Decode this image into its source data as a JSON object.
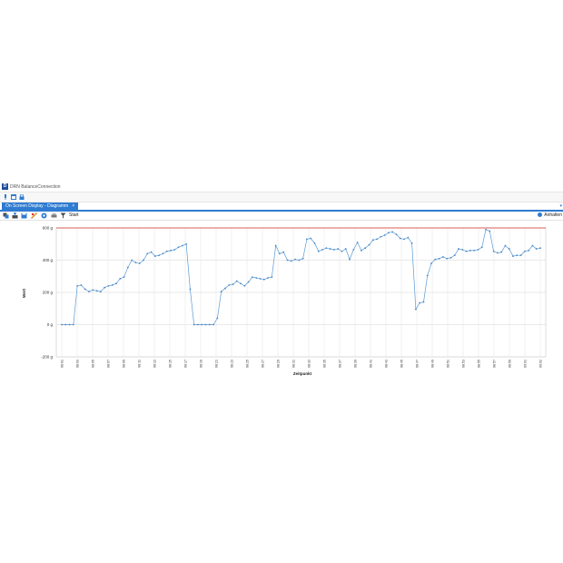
{
  "window": {
    "title": "DRN BalanceConnection",
    "icon_letter": "D",
    "document_tab": "On Screen Display - Diagramm",
    "tab_close": "×",
    "tab_scroll": "▾",
    "toolbar": {
      "start_label": "Start",
      "pause_label": "Anhalten"
    },
    "quick_icons": [
      "pin-icon",
      "layout-icon",
      "lock-icon"
    ],
    "toolbar_icons": [
      "copy-icon",
      "export-icon",
      "save-icon",
      "marker-icon",
      "settings-icon",
      "print-icon",
      "filter-icon"
    ]
  },
  "colors": {
    "accent": "#2f7bd1",
    "series": "#5b9bd5",
    "limit_line": "#d9322a"
  },
  "chart_data": {
    "type": "line",
    "xlabel": "Zeitpunkt",
    "ylabel": "Wert",
    "ylim": [
      -200,
      600
    ],
    "yticks": [
      -200,
      0,
      200,
      400,
      600
    ],
    "ytick_labels": [
      "-200 g",
      "0 g",
      "200 g",
      "400 g",
      "600 g"
    ],
    "limit_value": 600,
    "grid": true,
    "xtick_labels": [
      "08:01",
      "08:03",
      "08:05",
      "08:07",
      "08:09",
      "08:11",
      "08:13",
      "08:15",
      "08:17",
      "08:19",
      "08:21",
      "08:23",
      "08:25",
      "08:27",
      "08:29",
      "08:31",
      "08:33",
      "08:35",
      "08:37",
      "08:39",
      "08:41",
      "08:43",
      "08:45",
      "08:47",
      "08:49",
      "08:51",
      "08:53",
      "08:55",
      "08:57",
      "08:59",
      "09:01",
      "09:02"
    ],
    "series": [
      {
        "values": [
          0,
          0,
          0,
          0,
          240,
          245,
          220,
          205,
          215,
          210,
          205,
          230,
          240,
          245,
          255,
          285,
          295,
          355,
          400,
          385,
          380,
          400,
          440,
          450,
          425,
          430,
          440,
          455,
          460,
          465,
          480,
          490,
          500,
          220,
          0,
          0,
          0,
          0,
          0,
          0,
          40,
          205,
          225,
          245,
          250,
          270,
          255,
          240,
          265,
          295,
          290,
          285,
          280,
          290,
          295,
          490,
          440,
          450,
          400,
          395,
          405,
          400,
          410,
          530,
          535,
          505,
          455,
          465,
          475,
          470,
          465,
          470,
          455,
          470,
          405,
          465,
          510,
          460,
          475,
          495,
          525,
          530,
          545,
          555,
          570,
          575,
          560,
          535,
          530,
          540,
          505,
          95,
          135,
          140,
          305,
          380,
          405,
          410,
          420,
          410,
          415,
          430,
          470,
          465,
          455,
          460,
          460,
          465,
          480,
          590,
          580,
          455,
          445,
          450,
          490,
          470,
          425,
          430,
          430,
          455,
          460,
          490,
          470,
          475
        ]
      }
    ]
  }
}
